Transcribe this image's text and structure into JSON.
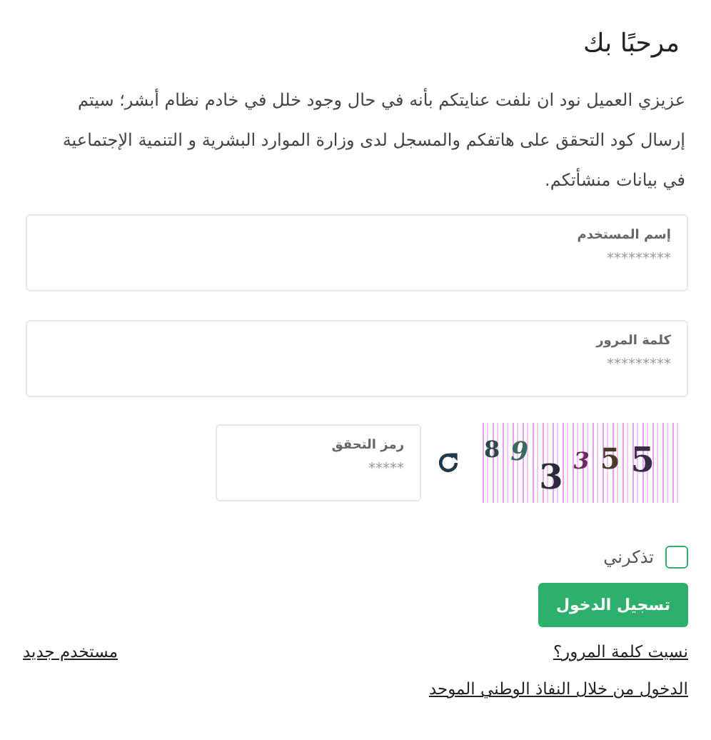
{
  "title": "مرحبًا بك",
  "notice": "عزيزي العميل نود ان نلفت عنايتكم بأنه في حال وجود خلل في خادم نظام أبشر؛ سيتم إرسال كود التحقق على هاتفكم والمسجل لدى وزارة الموارد البشرية و التنمية الإجتماعية في بيانات منشأتكم.",
  "fields": [
    {
      "label": "إسم المستخدم",
      "placeholder": "*********"
    },
    {
      "label": "كلمة المرور",
      "placeholder": "*********"
    }
  ],
  "captcha": {
    "label": "رمز التحقق",
    "placeholder": "*****",
    "text": "8 9 3 3 5 5"
  },
  "remember": {
    "label": "تذكرني",
    "checked": false
  },
  "login_button": "تسجيل الدخول",
  "links": {
    "forgot": "نسيت كلمة المرور؟",
    "new_user": "مستخدم جديد",
    "national": "الدخول من خلال النفاذ الوطني الموحد"
  }
}
